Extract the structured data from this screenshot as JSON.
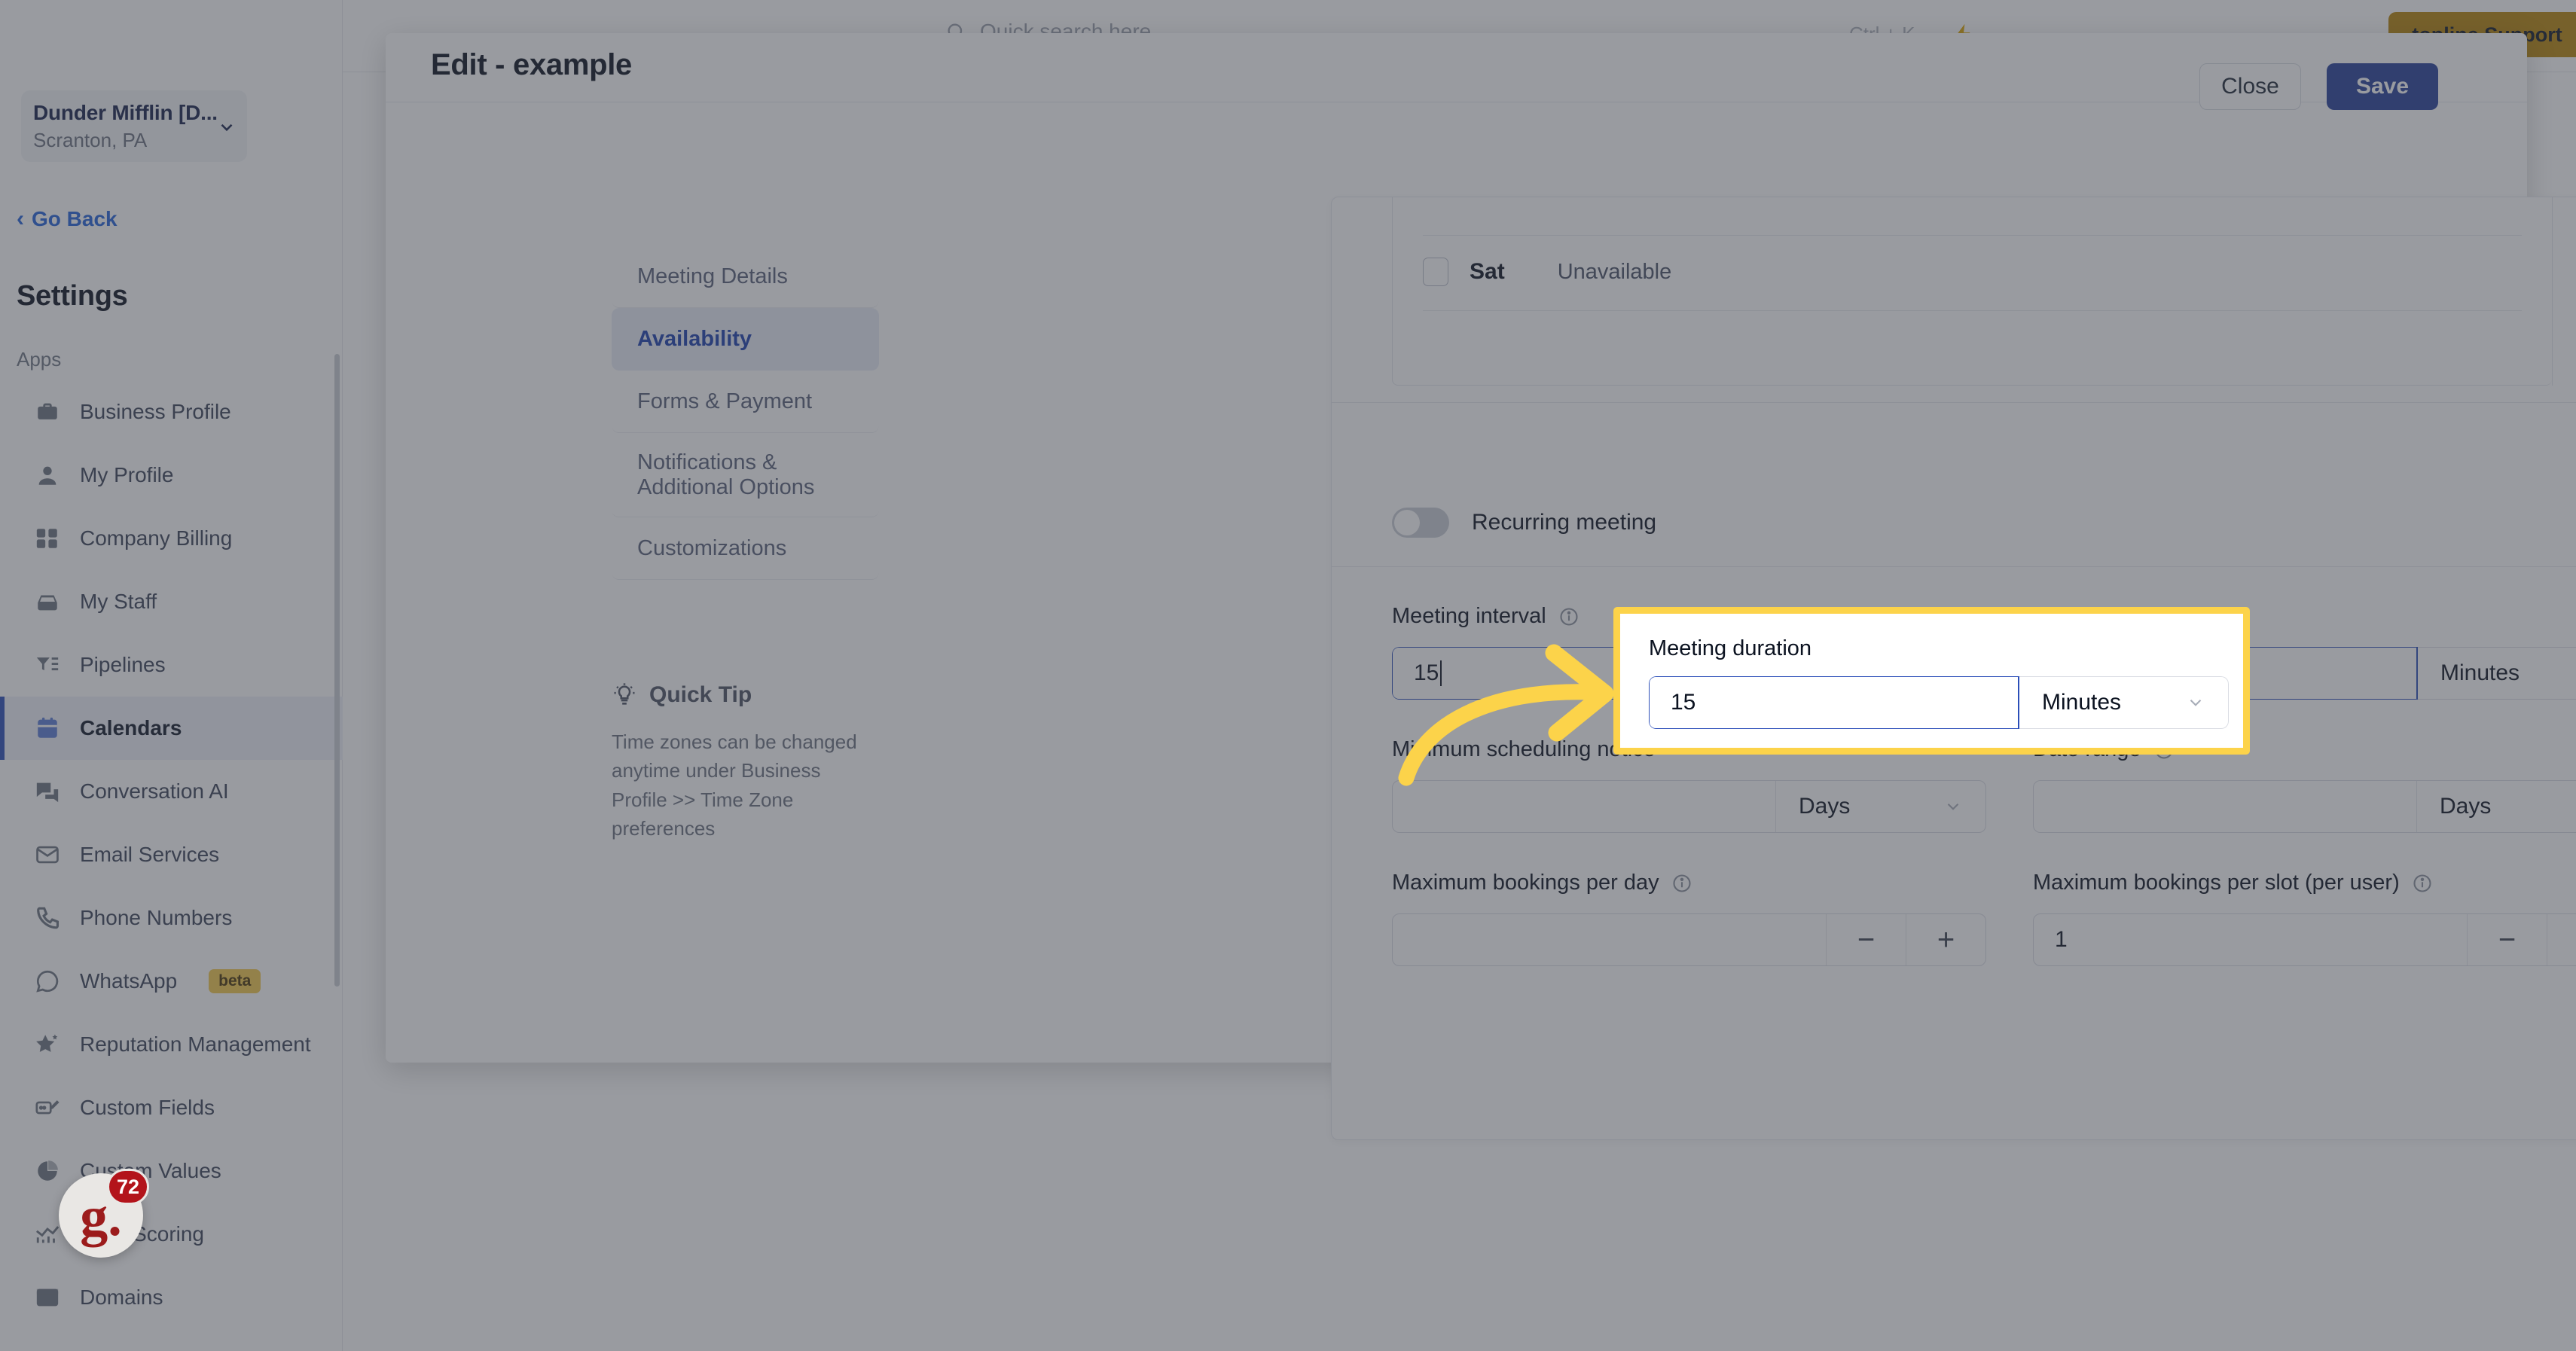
{
  "colors": {
    "accent_blue": "#2b4eb8",
    "save_blue": "#27409a",
    "highlight_yellow": "#fcd34a",
    "support_gold": "#b8860b",
    "beta_badge": "#f2c94c",
    "gong_red": "#9c1c1c"
  },
  "sidebar": {
    "location": {
      "name": "Dunder Mifflin [D...",
      "sub": "Scranton, PA"
    },
    "go_back": "Go Back",
    "settings_title": "Settings",
    "group_label": "Apps",
    "items": [
      {
        "label": "Business Profile",
        "icon": "briefcase-icon",
        "active": false
      },
      {
        "label": "My Profile",
        "icon": "user-icon",
        "active": false
      },
      {
        "label": "Company Billing",
        "icon": "calculator-icon",
        "active": false
      },
      {
        "label": "My Staff",
        "icon": "inbox-icon",
        "active": false
      },
      {
        "label": "Pipelines",
        "icon": "filter-list-icon",
        "active": false
      },
      {
        "label": "Calendars",
        "icon": "calendar-icon",
        "active": true
      },
      {
        "label": "Conversation AI",
        "icon": "chat-bubbles-icon",
        "active": false
      },
      {
        "label": "Email Services",
        "icon": "envelope-icon",
        "active": false
      },
      {
        "label": "Phone Numbers",
        "icon": "phone-icon",
        "active": false
      },
      {
        "label": "WhatsApp",
        "icon": "whatsapp-icon",
        "active": false,
        "badge": "beta"
      },
      {
        "label": "Reputation Management",
        "icon": "star-sparkle-icon",
        "active": false
      },
      {
        "label": "Custom Fields",
        "icon": "field-edit-icon",
        "active": false
      },
      {
        "label": "Custom Values",
        "icon": "pie-chart-icon",
        "active": false
      },
      {
        "label": "Lead Scoring",
        "icon": "chart-bars-icon",
        "active": false
      },
      {
        "label": "Domains",
        "icon": "browser-window-icon",
        "active": false
      }
    ]
  },
  "topbar": {
    "search_placeholder": "Quick search here",
    "search_icon": "search-icon",
    "shortcut": "Ctrl + K",
    "bolt_icon": "lightning-bolt-icon",
    "support_button": {
      "brand": "topline",
      "word": "Support"
    }
  },
  "modal": {
    "title": "Edit - example",
    "close_label": "Close",
    "save_label": "Save",
    "tabs": [
      {
        "label": "Meeting Details",
        "active": false,
        "arrow": ""
      },
      {
        "label": "Availability",
        "active": true,
        "arrow": "›"
      },
      {
        "label": "Forms & Payment",
        "active": false,
        "arrow": ""
      },
      {
        "label": "Notifications & Additional Options",
        "active": false,
        "arrow": ""
      },
      {
        "label": "Customizations",
        "active": false,
        "arrow": ""
      }
    ],
    "quick_tip": {
      "icon": "lightbulb-icon",
      "heading": "Quick Tip",
      "body": "Time zones can be changed anytime under Business Profile >> Time Zone preferences"
    }
  },
  "availability": {
    "day_row": {
      "day": "Sat",
      "state": "Unavailable",
      "checked": false
    },
    "recurring_meeting": {
      "label": "Recurring meeting",
      "enabled": false
    },
    "meeting_interval": {
      "label": "Meeting interval",
      "info_icon": "info-icon",
      "value": "15",
      "unit": "Minutes",
      "focused": true
    },
    "meeting_duration": {
      "label": "Meeting duration",
      "value": "15",
      "unit": "Minutes",
      "focused": true,
      "highlighted": true
    },
    "minimum_scheduling_notice": {
      "label": "Minimum scheduling notice",
      "value": "",
      "unit": "Days"
    },
    "date_range": {
      "label": "Date range",
      "info_icon": "info-icon",
      "value": "",
      "unit": "Days"
    },
    "maximum_bookings_per_day": {
      "label": "Maximum bookings per day",
      "info_icon": "info-icon",
      "value": "",
      "minus": "−",
      "plus": "+"
    },
    "maximum_bookings_per_slot": {
      "label": "Maximum bookings per slot (per user)",
      "info_icon": "info-icon",
      "value": "1",
      "minus": "−",
      "plus": "+"
    }
  },
  "annotation": {
    "arrow_icon": "curved-right-arrow-icon",
    "arrow_color": "#fcd34a",
    "target": "meeting_duration"
  },
  "gong_widget": {
    "logo": "g.",
    "count": "72"
  }
}
